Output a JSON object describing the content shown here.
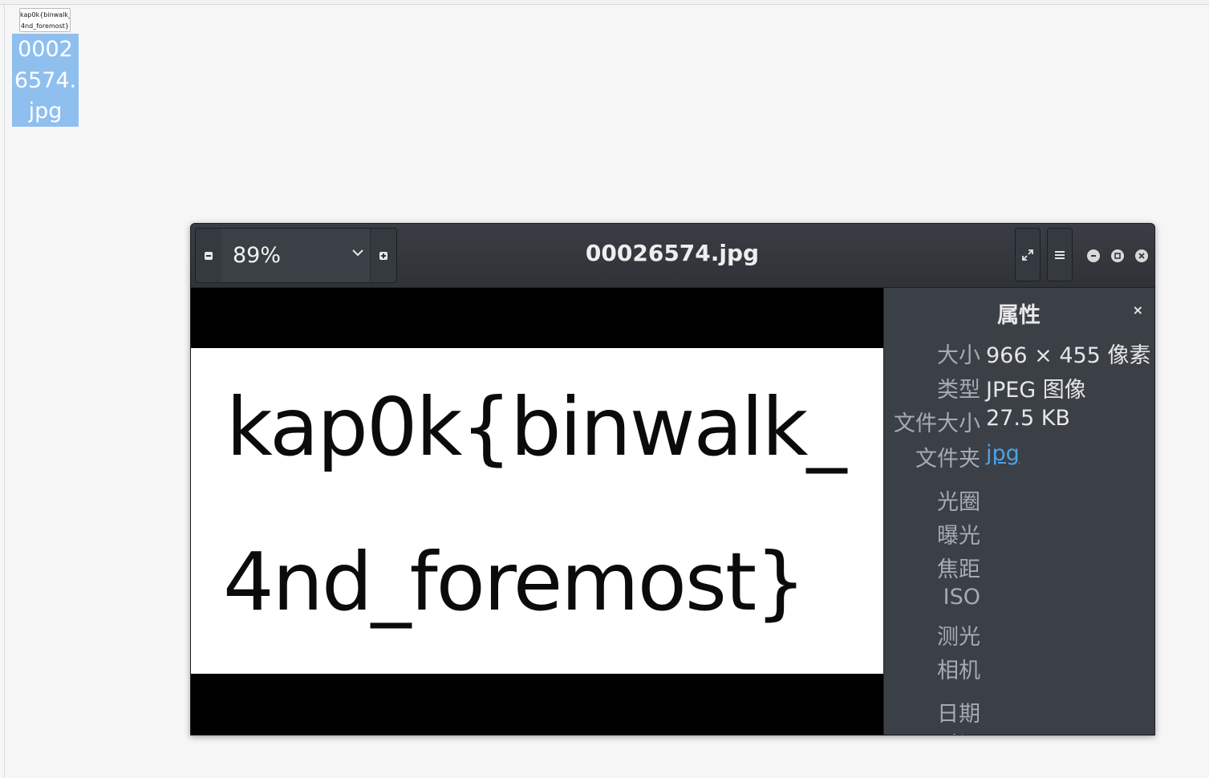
{
  "desktop": {
    "icon": {
      "thumbnail_lines": [
        "kap0k{binwalk_",
        "4nd_foremost}"
      ],
      "label_lines": [
        "0002",
        "6574.",
        "jpg"
      ]
    }
  },
  "viewer": {
    "zoom": {
      "value": "89%"
    },
    "title": "00026574.jpg",
    "image": {
      "line1": "kap0k{binwalk_",
      "line2": "4nd_foremost}"
    },
    "properties": {
      "title": "属性",
      "close": "×",
      "rows": [
        {
          "key": "大小",
          "value": "966 × 455 像素"
        },
        {
          "key": "类型",
          "value": "JPEG 图像"
        },
        {
          "key": "文件大小",
          "value": "27.5 KB"
        },
        {
          "key": "文件夹",
          "value": "jpg"
        },
        {
          "key": "光圈",
          "value": ""
        },
        {
          "key": "曝光",
          "value": ""
        },
        {
          "key": "焦距",
          "value": ""
        },
        {
          "key": "ISO",
          "value": ""
        },
        {
          "key": "测光",
          "value": ""
        },
        {
          "key": "相机",
          "value": ""
        },
        {
          "key": "日期",
          "value": ""
        },
        {
          "key": "时间",
          "value": ""
        }
      ]
    }
  }
}
